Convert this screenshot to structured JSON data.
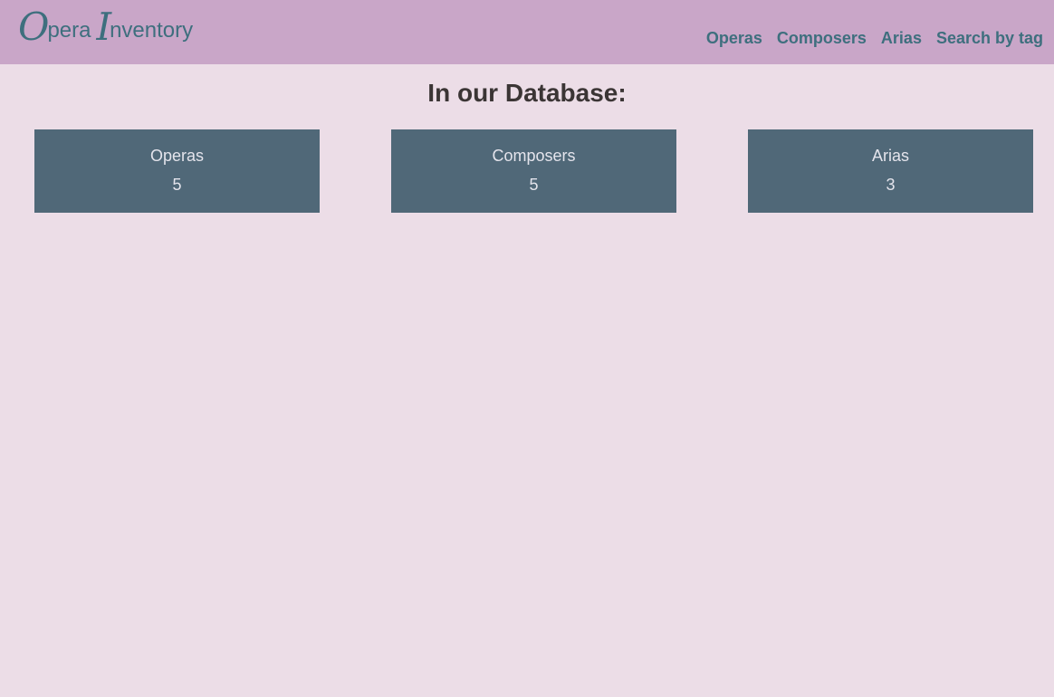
{
  "brand": {
    "first_cap": "O",
    "first_rest": "pera",
    "second_cap": "I",
    "second_rest": "nventory"
  },
  "nav": {
    "items": [
      {
        "label": "Operas"
      },
      {
        "label": "Composers"
      },
      {
        "label": "Arias"
      },
      {
        "label": "Search by tag"
      }
    ]
  },
  "main": {
    "title": "In our Database:",
    "cards": [
      {
        "label": "Operas",
        "count": "5"
      },
      {
        "label": "Composers",
        "count": "5"
      },
      {
        "label": "Arias",
        "count": "3"
      }
    ]
  },
  "colors": {
    "navbar_bg": "#c9a6c8",
    "page_bg": "#ecdde7",
    "accent_text": "#3e6f7e",
    "card_bg": "#506878",
    "card_text": "#e4e4ec"
  }
}
